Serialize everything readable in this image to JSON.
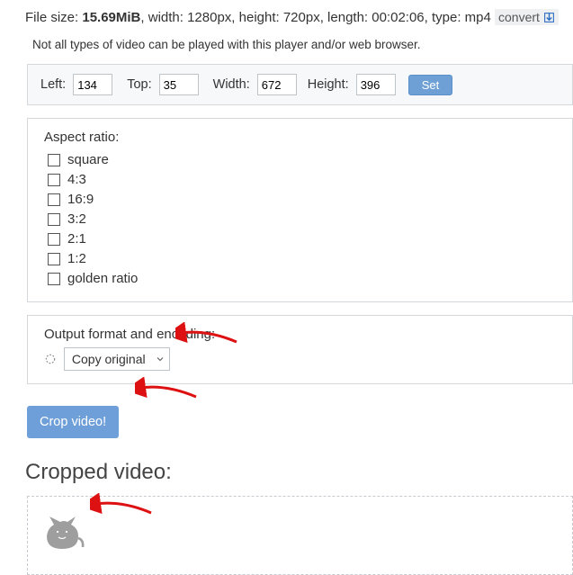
{
  "fileinfo": {
    "prefix": "File size: ",
    "size": "15.69MiB",
    "rest": ", width: 1280px, height: 720px, length: 00:02:06, type: mp4",
    "convert_label": "convert"
  },
  "note": "Not all types of video can be played with this player and/or web browser.",
  "coords": {
    "left_label": "Left:",
    "left_value": "134",
    "top_label": "Top:",
    "top_value": "35",
    "width_label": "Width:",
    "width_value": "672",
    "height_label": "Height:",
    "height_value": "396",
    "set_label": "Set"
  },
  "aspect": {
    "title": "Aspect ratio:",
    "options": [
      "square",
      "4:3",
      "16:9",
      "3:2",
      "2:1",
      "1:2",
      "golden ratio"
    ]
  },
  "output": {
    "title": "Output format and encoding:",
    "selected": "Copy original"
  },
  "crop_label": "Crop video!",
  "result_title": "Cropped video:"
}
